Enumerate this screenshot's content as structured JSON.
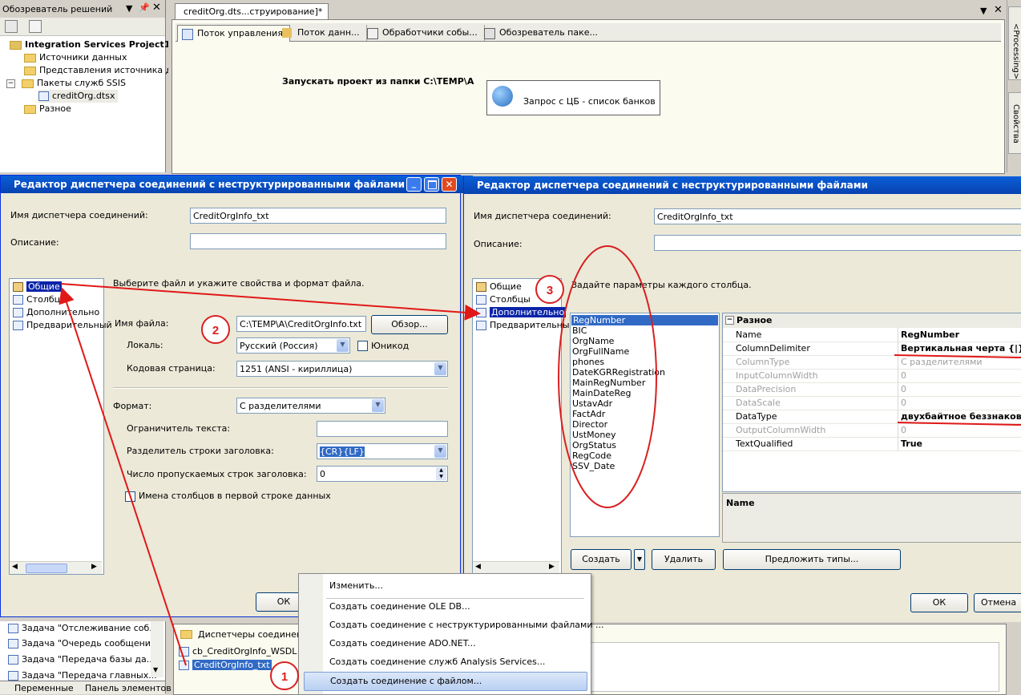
{
  "solution_explorer": {
    "title": "Обозреватель решений",
    "project": "Integration Services Project1",
    "items": [
      "Источники данных",
      "Представления источника дан",
      "Пакеты служб SSIS",
      "creditOrg.dtsx",
      "Разное"
    ]
  },
  "document": {
    "tab_title": "creditOrg.dts...струирование]*",
    "tabs": [
      "Поток управления",
      "Поток данн...",
      "Обработчики собы...",
      "Обозреватель паке..."
    ],
    "annotation": "Запускать проект из папки C:\\TEMP\\A",
    "task_label": "Запрос с ЦБ - список банков"
  },
  "right_strip": {
    "processing": "<Processing>",
    "properties": "Свойства"
  },
  "left_editor": {
    "title": "Редактор диспетчера соединений с неструктурированными файлами",
    "name_label": "Имя диспетчера соединений:",
    "name_value": "CreditOrgInfo_txt",
    "desc_label": "Описание:",
    "nav": [
      "Общие",
      "Столбцы",
      "Дополнительно",
      "Предварительный"
    ],
    "hint": "Выберите файл и укажите свойства и формат файла.",
    "file_label": "Имя файла:",
    "file_value": "C:\\TEMP\\A\\CreditOrgInfo.txt",
    "browse": "Обзор...",
    "locale_label": "Локаль:",
    "locale_value": "Русский (Россия)",
    "unicode_label": "Юникод",
    "codepage_label": "Кодовая страница:",
    "codepage_value": "1251  (ANSI - кириллица)",
    "format_label": "Формат:",
    "format_value": "С разделителями",
    "text_qual_label": "Ограничитель текста:",
    "header_delim_label": "Разделитель строки заголовка:",
    "header_delim_value": "{CR}{LF}",
    "skip_rows_label": "Число пропускаемых строк заголовка:",
    "skip_rows_value": "0",
    "colnames_label": "Имена столбцов в первой строке данных",
    "ok": "ОК"
  },
  "right_editor": {
    "title": "Редактор диспетчера соединений с неструктурированными файлами",
    "name_label": "Имя диспетчера соединений:",
    "name_value": "CreditOrgInfo_txt",
    "desc_label": "Описание:",
    "nav": [
      "Общие",
      "Столбцы",
      "Дополнительно",
      "Предварительный"
    ],
    "hint": "Задайте параметры каждого столбца.",
    "columns": [
      "RegNumber",
      "BIC",
      "OrgName",
      "OrgFullName",
      "phones",
      "DateKGRRegistration",
      "MainRegNumber",
      "MainDateReg",
      "UstavAdr",
      "FactAdr",
      "Director",
      "UstMoney",
      "OrgStatus",
      "RegCode",
      "SSV_Date"
    ],
    "prop_category": "Разное",
    "props": [
      {
        "name": "Name",
        "value": "RegNumber"
      },
      {
        "name": "ColumnDelimiter",
        "value": "Вертикальная черта {|}"
      },
      {
        "name": "ColumnType",
        "value": "С разделителями"
      },
      {
        "name": "InputColumnWidth",
        "value": "0"
      },
      {
        "name": "DataPrecision",
        "value": "0"
      },
      {
        "name": "DataScale",
        "value": "0"
      },
      {
        "name": "DataType",
        "value": "двухбайтное беззнаково"
      },
      {
        "name": "OutputColumnWidth",
        "value": "0"
      },
      {
        "name": "TextQualified",
        "value": "True"
      }
    ],
    "desc_title": "Name",
    "create": "Создать",
    "delete": "Удалить",
    "suggest": "Предложить типы...",
    "ok": "ОК",
    "cancel": "Отмена"
  },
  "toolbox": {
    "items": [
      "Задача \"Отслеживание соб...",
      "Задача \"Очередь сообщений\"",
      "Задача \"Передача базы да...",
      "Задача \"Передача главных..."
    ],
    "tabs": [
      "Переменные",
      "Панель элементов"
    ]
  },
  "conn_managers": {
    "title": "Диспетчеры соединений",
    "items": [
      "cb_CreditOrgInfo_WSDL",
      "CreditOrgInfo_txt"
    ]
  },
  "context_menu": [
    "Изменить...",
    "Создать соединение OLE DB...",
    "Создать соединение с неструктурированными файлами ...",
    "Создать соединение ADO.NET...",
    "Создать соединение служб Analysis Services...",
    "Создать соединение с файлом..."
  ],
  "callouts": [
    "1",
    "2",
    "3"
  ]
}
